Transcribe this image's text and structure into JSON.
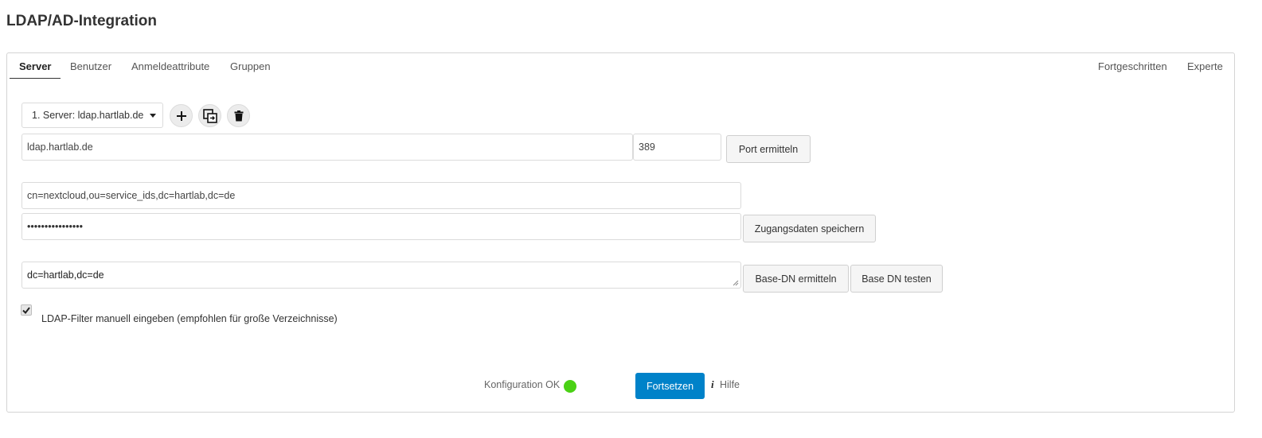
{
  "title": "LDAP/AD-Integration",
  "tabs_left": [
    "Server",
    "Benutzer",
    "Anmeldeattribute",
    "Gruppen"
  ],
  "tabs_right": [
    "Fortgeschritten",
    "Experte"
  ],
  "server_select": {
    "value": "1. Server: ldap.hartlab.de"
  },
  "host": {
    "value": "ldap.hartlab.de"
  },
  "port": {
    "value": "389"
  },
  "buttons": {
    "port_detect": "Port ermitteln",
    "save_credentials": "Zugangsdaten speichern",
    "base_dn_detect": "Base-DN ermitteln",
    "base_dn_test": "Base DN testen",
    "continue": "Fortsetzen"
  },
  "bind_dn": {
    "value": "cn=nextcloud,ou=service_ids,dc=hartlab,dc=de"
  },
  "password": {
    "value": "••••••••••••••••"
  },
  "base_dn": {
    "value": "dc=hartlab,dc=de"
  },
  "manual_filter": {
    "label": "LDAP-Filter manuell eingeben (empfohlen für große Verzeichnisse)",
    "checked": true
  },
  "status": {
    "text": "Konfiguration OK",
    "color": "#4ad115"
  },
  "help": {
    "icon_glyph": "i",
    "label": "Hilfe"
  },
  "colors": {
    "primary": "#0082c9"
  }
}
